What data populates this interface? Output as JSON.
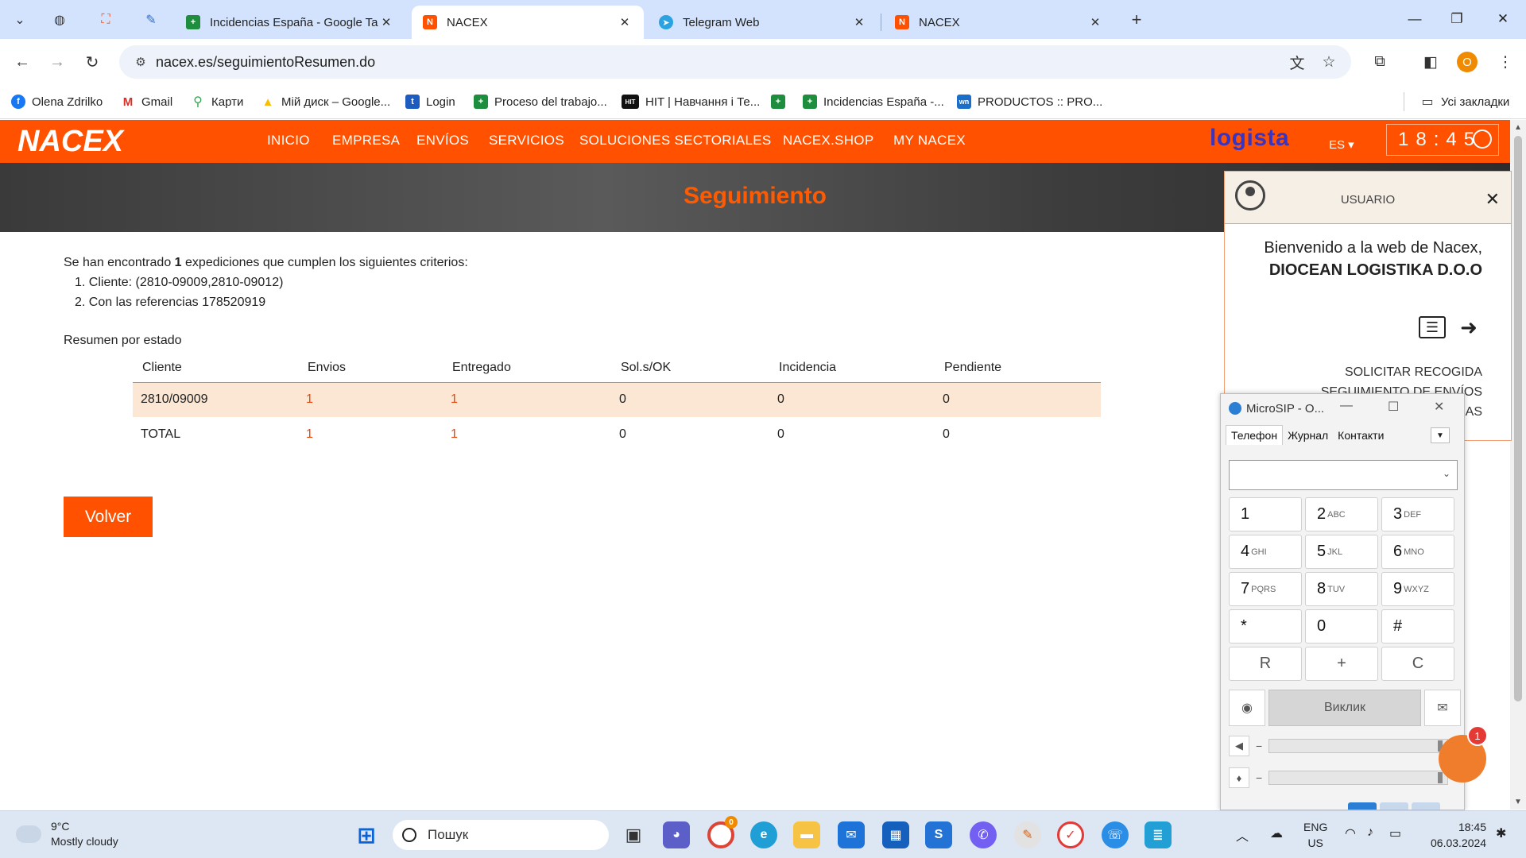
{
  "browser": {
    "tabs": [
      {
        "title": "Incidencias España - Google Ta",
        "favicon": "google-sheets",
        "active": false
      },
      {
        "title": "NACEX",
        "favicon": "nacex",
        "active": true
      },
      {
        "title": "Telegram Web",
        "favicon": "telegram",
        "active": false
      },
      {
        "title": "NACEX",
        "favicon": "nacex",
        "active": false
      }
    ],
    "url": "nacex.es/seguimientoResumen.do",
    "profile_initial": "O",
    "bookmarks": [
      {
        "label": "Olena Zdrilko",
        "icon": "facebook"
      },
      {
        "label": "Gmail",
        "icon": "gmail"
      },
      {
        "label": "Карти",
        "icon": "maps"
      },
      {
        "label": "Мій диск – Google...",
        "icon": "drive"
      },
      {
        "label": "Login",
        "icon": "login"
      },
      {
        "label": "Proceso del trabajo...",
        "icon": "sheets"
      },
      {
        "label": "HIT | Навчання і Те...",
        "icon": "hit"
      },
      {
        "label": "",
        "icon": "sheets"
      },
      {
        "label": "Incidencias España -...",
        "icon": "sheets"
      },
      {
        "label": "PRODUCTOS :: PRO...",
        "icon": "wn"
      }
    ],
    "all_bookmarks": "Усі закладки"
  },
  "nacex": {
    "logo": "NACEX",
    "nav": [
      "INICIO",
      "EMPRESA",
      "ENVÍOS",
      "SERVICIOS",
      "SOLUCIONES SECTORIALES",
      "NACEX.SHOP",
      "MY NACEX"
    ],
    "partner_logo": "logista",
    "lang": "ES",
    "clock": "18:45",
    "banner_title": "Seguimiento",
    "result_prefix": "Se han encontrado ",
    "result_count": "1",
    "result_suffix": " expediciones que cumplen los siguientes criterios:",
    "criteria": [
      "1. Cliente: (2810-09009,2810-09012)",
      "2. Con las referencias 178520919"
    ],
    "summary_title": "Resumen por estado",
    "table": {
      "headers": [
        "Cliente",
        "Envios",
        "Entregado",
        "Sol.s/OK",
        "Incidencia",
        "Pendiente"
      ],
      "rows": [
        [
          "2810/09009",
          "1",
          "1",
          "0",
          "0",
          "0"
        ],
        [
          "TOTAL",
          "1",
          "1",
          "0",
          "0",
          "0"
        ]
      ]
    },
    "back_button": "Volver",
    "accent": "#ff5100"
  },
  "user_panel": {
    "label": "USUARIO",
    "welcome": "Bienvenido a la web de Nacex,",
    "company": "DIOCEAN LOGISTIKA D.O.O",
    "links": [
      "SOLICITAR RECOGIDA",
      "SEGUIMIENTO DE ENVÍOS",
      "AS"
    ]
  },
  "microsip": {
    "title": "MicroSIP - O...",
    "tabs": [
      "Телефон",
      "Журнал",
      "Контакти"
    ],
    "keys": [
      {
        "d": "1",
        "l": ""
      },
      {
        "d": "2",
        "l": "ABC"
      },
      {
        "d": "3",
        "l": "DEF"
      },
      {
        "d": "4",
        "l": "GHI"
      },
      {
        "d": "5",
        "l": "JKL"
      },
      {
        "d": "6",
        "l": "MNO"
      },
      {
        "d": "7",
        "l": "PQRS"
      },
      {
        "d": "8",
        "l": "TUV"
      },
      {
        "d": "9",
        "l": "WXYZ"
      },
      {
        "d": "*",
        "l": ""
      },
      {
        "d": "0",
        "l": ""
      },
      {
        "d": "#",
        "l": ""
      },
      {
        "d": "R",
        "l": ""
      },
      {
        "d": "+",
        "l": ""
      },
      {
        "d": "C",
        "l": ""
      }
    ],
    "call_label": "Виклик"
  },
  "chat_badge": "1",
  "taskbar": {
    "weather_temp": "9°C",
    "weather_desc": "Mostly cloudy",
    "search_placeholder": "Пошук",
    "chrome_badge": "0",
    "lang": "ENG",
    "region": "US",
    "time": "18:45",
    "date": "06.03.2024"
  }
}
